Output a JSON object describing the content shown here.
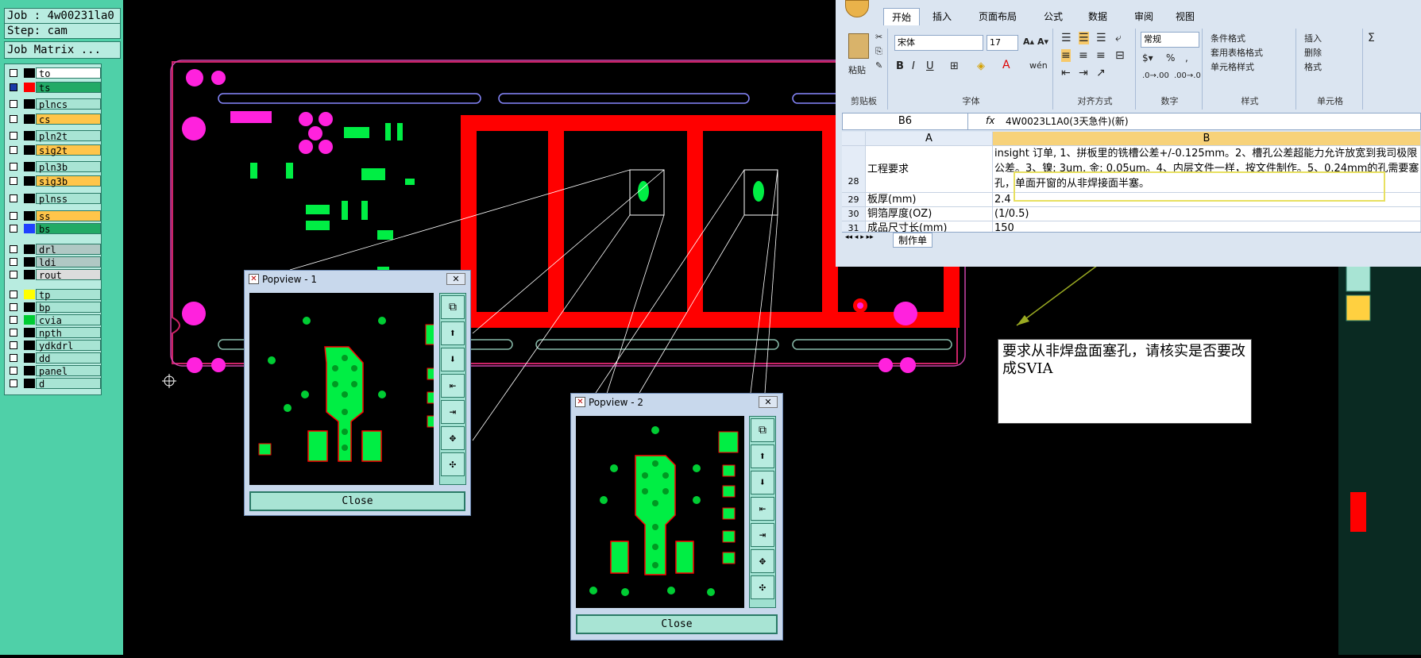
{
  "job": {
    "job_label": "Job : 4w00231la0",
    "step_label": "Step: cam",
    "matrix_button": "Job Matrix ..."
  },
  "layers": [
    {
      "name": "to",
      "color": "#ffffff",
      "swatch": "#000000",
      "checked": false
    },
    {
      "name": "ts",
      "color": "#22aa66",
      "swatch": "#ff0000",
      "checked": true
    },
    {
      "name": "plncs",
      "color": "#a8e4d4",
      "swatch": "#000000",
      "checked": false
    },
    {
      "name": "cs",
      "color": "#ffc54a",
      "swatch": "#000000",
      "checked": false
    },
    {
      "name": "pln2t",
      "color": "#a8e4d4",
      "swatch": "#000000",
      "checked": false
    },
    {
      "name": "sig2t",
      "color": "#ffc54a",
      "swatch": "#000000",
      "checked": false
    },
    {
      "name": "pln3b",
      "color": "#a8e4d4",
      "swatch": "#000000",
      "checked": false
    },
    {
      "name": "sig3b",
      "color": "#ffc54a",
      "swatch": "#000000",
      "checked": false
    },
    {
      "name": "plnss",
      "color": "#a8e4d4",
      "swatch": "#000000",
      "checked": false
    },
    {
      "name": "ss",
      "color": "#ffc54a",
      "swatch": "#000000",
      "checked": false
    },
    {
      "name": "bs",
      "color": "#22aa66",
      "swatch": "#2040ff",
      "checked": false
    },
    {
      "name": "drl",
      "color": "#b0c8c4",
      "swatch": "#000000",
      "checked": false
    },
    {
      "name": "ldi",
      "color": "#b0c8c4",
      "swatch": "#000000",
      "checked": false
    },
    {
      "name": "rout",
      "color": "#dcdcdc",
      "swatch": "#000000",
      "checked": false
    },
    {
      "name": "tp",
      "color": "#a8e4d4",
      "swatch": "#ffff00",
      "checked": false
    },
    {
      "name": "bp",
      "color": "#a8e4d4",
      "swatch": "#000000",
      "checked": false
    },
    {
      "name": "cvia",
      "color": "#a8e4d4",
      "swatch": "#00cc33",
      "checked": false
    },
    {
      "name": "npth",
      "color": "#a8e4d4",
      "swatch": "#000000",
      "checked": false
    },
    {
      "name": "ydkdrl",
      "color": "#a8e4d4",
      "swatch": "#000000",
      "checked": false
    },
    {
      "name": "dd",
      "color": "#a8e4d4",
      "swatch": "#000000",
      "checked": false
    },
    {
      "name": "panel",
      "color": "#a8e4d4",
      "swatch": "#000000",
      "checked": false
    },
    {
      "name": "d",
      "color": "#a8e4d4",
      "swatch": "#000000",
      "checked": false
    }
  ],
  "popview1": {
    "title": "Popview - 1",
    "close_label": "Close"
  },
  "popview2": {
    "title": "Popview - 2",
    "close_label": "Close"
  },
  "excel": {
    "tabs": [
      "开始",
      "插入",
      "页面布局",
      "公式",
      "数据",
      "审阅",
      "视图"
    ],
    "active_tab": "开始",
    "font_name": "宋体",
    "font_size": "17",
    "number_format": "常规",
    "groups": {
      "clipboard": "剪贴板",
      "font": "字体",
      "align": "对齐方式",
      "number": "数字",
      "styles": "样式",
      "cells": "单元格"
    },
    "paste_label": "粘贴",
    "styles_items": [
      "条件格式",
      "套用表格格式",
      "单元格样式"
    ],
    "cells_items": [
      "插入",
      "删除",
      "格式"
    ],
    "name_box": "B6",
    "formula": "4W0023L1A0(3天急件)(新)",
    "col_a": "A",
    "col_b": "B",
    "rows": [
      {
        "num": "28",
        "a": "工程要求",
        "b": "insight 订单, 1、拼板里的铣槽公差+/-0.125mm。2、槽孔公差超能力允许放宽到我司极限公差。3、镍: 3um, 金: 0.05um。4、内层文件一样，按文件制作。5、0.24mm的孔需要塞孔，单面开窗的从非焊接面半塞。"
      },
      {
        "num": "29",
        "a": "板厚(mm)",
        "b": "2.4"
      },
      {
        "num": "30",
        "a": "铜箔厚度(OZ)",
        "b": "(1/0.5)"
      },
      {
        "num": "31",
        "a": "成品尺寸长(mm)",
        "b": "150"
      }
    ],
    "sheet_tab": "制作单"
  },
  "note": "要求从非焊盘面塞孔，请核实是否要改成SVIA",
  "colors": {
    "board_red": "#ff0000",
    "pad_green": "#00ee44",
    "pad_magenta": "#ff22dd",
    "panel_teal": "#4fd0a8"
  }
}
